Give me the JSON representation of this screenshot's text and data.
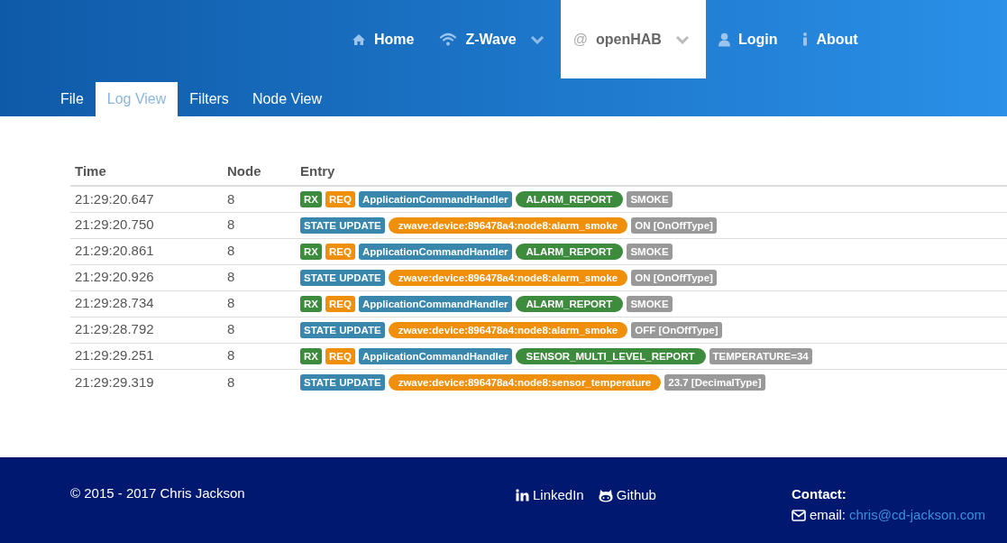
{
  "nav": [
    {
      "label": "Home",
      "dropdown": false,
      "selected": false
    },
    {
      "label": "Z-Wave",
      "dropdown": true,
      "selected": false
    },
    {
      "symbol": "@",
      "label": "openHAB",
      "dropdown": true,
      "selected": true
    },
    {
      "label": "Login",
      "dropdown": false,
      "selected": false
    },
    {
      "label": "About",
      "dropdown": false,
      "selected": false
    }
  ],
  "tabs": [
    {
      "label": "File",
      "selected": false
    },
    {
      "label": "Log View",
      "selected": true
    },
    {
      "label": "Filters",
      "selected": false
    },
    {
      "label": "Node View",
      "selected": false
    }
  ],
  "table": {
    "columns": [
      "Time",
      "Node",
      "Entry"
    ],
    "rows": [
      {
        "time": "21:29:20.647",
        "node": "8",
        "entry": [
          {
            "kind": "rx",
            "text": "RX"
          },
          {
            "kind": "req",
            "text": "REQ"
          },
          {
            "kind": "class",
            "text": "ApplicationCommandHandler"
          },
          {
            "kind": "command",
            "text": "ALARM_REPORT"
          },
          {
            "kind": "value",
            "text": "SMOKE"
          }
        ]
      },
      {
        "time": "21:29:20.750",
        "node": "8",
        "entry": [
          {
            "kind": "state",
            "text": "STATE UPDATE"
          },
          {
            "kind": "item",
            "text": "zwave:device:896478a4:node8:alarm_smoke"
          },
          {
            "kind": "value",
            "text": "ON [OnOffType]"
          }
        ]
      },
      {
        "time": "21:29:20.861",
        "node": "8",
        "entry": [
          {
            "kind": "rx",
            "text": "RX"
          },
          {
            "kind": "req",
            "text": "REQ"
          },
          {
            "kind": "class",
            "text": "ApplicationCommandHandler"
          },
          {
            "kind": "command",
            "text": "ALARM_REPORT"
          },
          {
            "kind": "value",
            "text": "SMOKE"
          }
        ]
      },
      {
        "time": "21:29:20.926",
        "node": "8",
        "entry": [
          {
            "kind": "state",
            "text": "STATE UPDATE"
          },
          {
            "kind": "item",
            "text": "zwave:device:896478a4:node8:alarm_smoke"
          },
          {
            "kind": "value",
            "text": "ON [OnOffType]"
          }
        ]
      },
      {
        "time": "21:29:28.734",
        "node": "8",
        "entry": [
          {
            "kind": "rx",
            "text": "RX"
          },
          {
            "kind": "req",
            "text": "REQ"
          },
          {
            "kind": "class",
            "text": "ApplicationCommandHandler"
          },
          {
            "kind": "command",
            "text": "ALARM_REPORT"
          },
          {
            "kind": "value",
            "text": "SMOKE"
          }
        ]
      },
      {
        "time": "21:29:28.792",
        "node": "8",
        "entry": [
          {
            "kind": "state",
            "text": "STATE UPDATE"
          },
          {
            "kind": "item",
            "text": "zwave:device:896478a4:node8:alarm_smoke"
          },
          {
            "kind": "value",
            "text": "OFF [OnOffType]"
          }
        ]
      },
      {
        "time": "21:29:29.251",
        "node": "8",
        "entry": [
          {
            "kind": "rx",
            "text": "RX"
          },
          {
            "kind": "req",
            "text": "REQ"
          },
          {
            "kind": "class",
            "text": "ApplicationCommandHandler"
          },
          {
            "kind": "command",
            "text": "SENSOR_MULTI_LEVEL_REPORT"
          },
          {
            "kind": "value",
            "text": "TEMPERATURE=34"
          }
        ]
      },
      {
        "time": "21:29:29.319",
        "node": "8",
        "entry": [
          {
            "kind": "state",
            "text": "STATE UPDATE"
          },
          {
            "kind": "item",
            "text": "zwave:device:896478a4:node8:sensor_temperature"
          },
          {
            "kind": "value",
            "text": "23.7 [DecimalType]"
          }
        ]
      }
    ]
  },
  "footer": {
    "copyright": "© 2015 - 2017 Chris Jackson",
    "links": [
      {
        "label": "LinkedIn"
      },
      {
        "label": "Github"
      }
    ],
    "contact_heading": "Contact:",
    "email_label": "email:",
    "email": "chris@cd-jackson.com"
  }
}
